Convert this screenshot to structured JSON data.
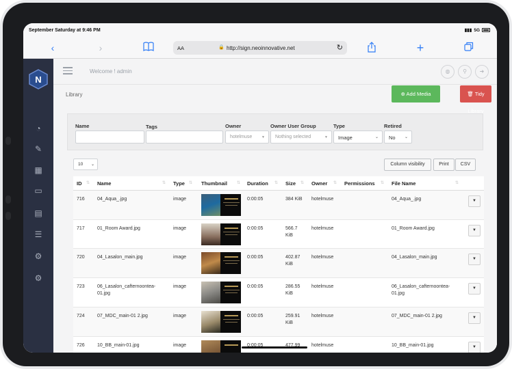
{
  "status": {
    "time": "September Saturday at 9:46 PM",
    "signal": "5G"
  },
  "browser": {
    "aa": "AA",
    "url": "http://sign.neoinnovative.net"
  },
  "header": {
    "welcome": "Welcome ! admin"
  },
  "page": {
    "title": "Library",
    "add_media": "Add Media",
    "tidy_library": "Tidy Library"
  },
  "filters": {
    "name_label": "Name",
    "tags_label": "Tags",
    "owner_label": "Owner",
    "owner_group_label": "Owner User Group",
    "type_label": "Type",
    "retired_label": "Retired",
    "owner_value": "hotelmuse",
    "owner_group_value": "Nothing selected",
    "type_value": "Image",
    "retired_value": "No"
  },
  "table_controls": {
    "page_length": "10",
    "column_visibility": "Column visibility",
    "print": "Print",
    "csv": "CSV"
  },
  "columns": [
    "ID",
    "Name",
    "Type",
    "Thumbnail",
    "Duration",
    "Size",
    "Owner",
    "Permissions",
    "File Name"
  ],
  "rows": [
    {
      "id": "716",
      "name": "04_Aqua_.jpg",
      "type": "image",
      "duration": "0:00:05",
      "size": "384 KiB",
      "owner": "hotelmuse",
      "file": "04_Aqua_.jpg"
    },
    {
      "id": "717",
      "name": "01_Room Award.jpg",
      "type": "image",
      "duration": "0:00:05",
      "size": "566.7 KiB",
      "owner": "hotelmuse",
      "file": "01_Room Award.jpg"
    },
    {
      "id": "720",
      "name": "04_Lasalon_main.jpg",
      "type": "image",
      "duration": "0:00:05",
      "size": "402.87 KiB",
      "owner": "hotelmuse",
      "file": "04_Lasalon_main.jpg"
    },
    {
      "id": "723",
      "name": "06_Lasalon_cafternoontea-01.jpg",
      "type": "image",
      "duration": "0:00:05",
      "size": "286.55 KiB",
      "owner": "hotelmuse",
      "file": "06_Lasalon_cafternoontea-01.jpg"
    },
    {
      "id": "724",
      "name": "07_MDC_main-01 2.jpg",
      "type": "image",
      "duration": "0:00:05",
      "size": "259.91 KiB",
      "owner": "hotelmuse",
      "file": "07_MDC_main-01 2.jpg"
    },
    {
      "id": "726",
      "name": "10_BB_main-01.jpg",
      "type": "image",
      "duration": "0:00:05",
      "size": "477.99",
      "owner": "hotelmuse",
      "file": "10_BB_main-01.jpg"
    }
  ],
  "colors": {
    "sidebar": "#2a3042",
    "add": "#5cb85c",
    "tidy": "#d9534f",
    "ios_blue": "#2f7cf6"
  }
}
